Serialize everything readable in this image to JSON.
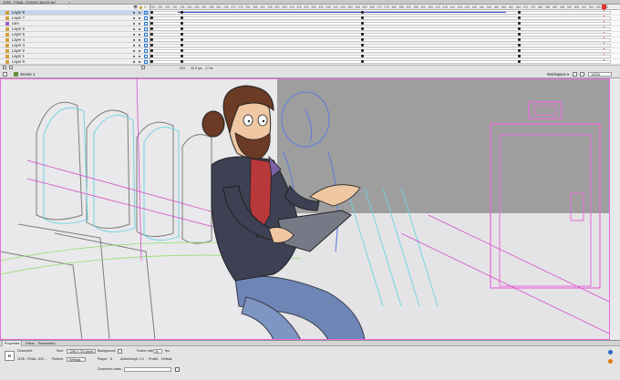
{
  "window": {
    "document_tab": "1195 - FINAL JOKING BACK.fla*",
    "close_glyph": "×"
  },
  "timeline": {
    "header_icons": {
      "eye": "👁",
      "lock": "🔒",
      "outline": "□"
    },
    "layers": [
      {
        "name": "Layer 8",
        "selected": true
      },
      {
        "name": "Layer 7",
        "selected": false
      },
      {
        "name": "cam",
        "selected": false
      },
      {
        "name": "Layer 6",
        "selected": false
      },
      {
        "name": "Layer 5",
        "selected": false
      },
      {
        "name": "Layer 4",
        "selected": false
      },
      {
        "name": "Layer 3",
        "selected": false
      },
      {
        "name": "Layer 2",
        "selected": false
      },
      {
        "name": "Layer 1",
        "selected": false
      },
      {
        "name": "Layer 9",
        "selected": false
      }
    ],
    "ruler_ticks": [
      "215",
      "220",
      "225",
      "230",
      "235",
      "240",
      "245",
      "250",
      "255",
      "260",
      "265",
      "270",
      "275",
      "280",
      "285",
      "290",
      "295",
      "300",
      "305",
      "310",
      "315",
      "320",
      "325",
      "330",
      "335",
      "340",
      "345",
      "350",
      "355",
      "360",
      "365",
      "370",
      "375",
      "380",
      "385",
      "390",
      "395",
      "400",
      "405",
      "410",
      "415",
      "420",
      "425",
      "430",
      "435",
      "440",
      "445",
      "450",
      "455",
      "460",
      "465",
      "470",
      "475",
      "480",
      "485",
      "490",
      "495",
      "500",
      "505",
      "510",
      "515",
      "520",
      "525"
    ],
    "status": {
      "frame": "525",
      "fps": "30.0 fps",
      "time": "17.5s"
    },
    "accent_color": "#2a7bd8",
    "playhead_color": "#e03030"
  },
  "editbar": {
    "scene_label": "Scene 1",
    "workspace_label": "Workspace ▾",
    "zoom_value": "100%"
  },
  "properties": {
    "tabs": [
      "Properties",
      "Filters",
      "Parameters"
    ],
    "object_type": "Document",
    "icon_text": "Fl",
    "file_name": "1195 - FINAL JOK...",
    "size_label": "Size:",
    "size_button": "1280 x 720 pixels",
    "background_label": "Background:",
    "background_color": "#ffffff",
    "frame_rate_label": "Frame rate:",
    "frame_rate_value": "30",
    "fps_unit": "fps",
    "publish_label": "Publish:",
    "settings_button": "Settings...",
    "player_label": "Player:",
    "player_value": "8",
    "actionscript_label": "ActionScript:",
    "actionscript_value": "2.0",
    "profile_label": "Profile:",
    "profile_value": "Default",
    "document_class_label": "Document class:",
    "document_class_value": ""
  }
}
